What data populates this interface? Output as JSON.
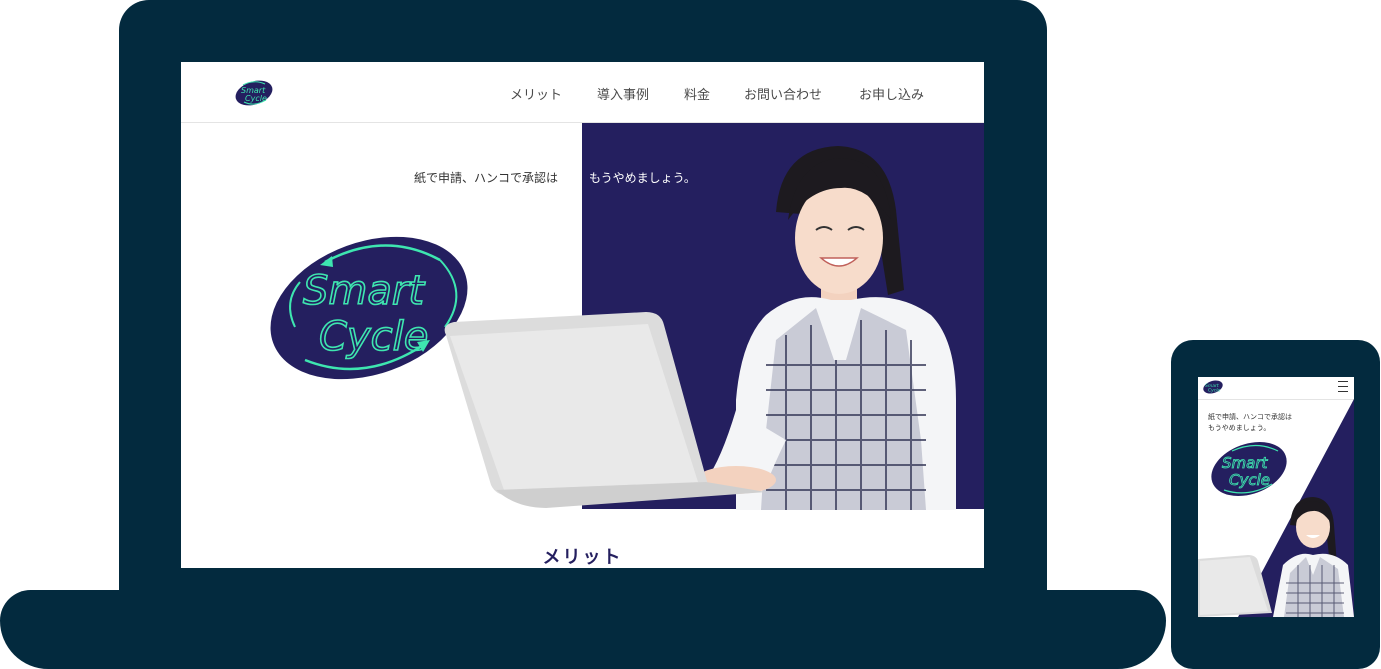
{
  "brand": {
    "line1": "Smart",
    "line2": "Cycle"
  },
  "nav": {
    "items": [
      {
        "label": "メリット"
      },
      {
        "label": "導入事例"
      },
      {
        "label": "料金"
      },
      {
        "label": "お問い合わせ"
      },
      {
        "label": "お申し込み"
      }
    ]
  },
  "hero": {
    "tagline_part1": "紙で申請、ハンコで承認は",
    "tagline_part2": "もうやめましょう。"
  },
  "sections": {
    "merit_title": "メリット"
  },
  "mobile": {
    "tagline_line1": "紙で申請、ハンコで承認は",
    "tagline_line2": "もうやめましょう。"
  },
  "colors": {
    "device_frame": "#032a3e",
    "brand_navy": "#241f5f",
    "brand_mint": "#3ee6b0"
  }
}
